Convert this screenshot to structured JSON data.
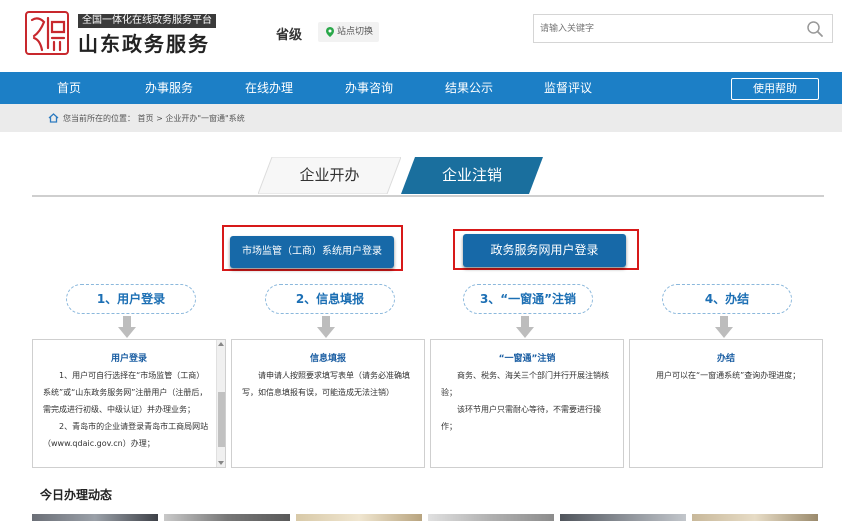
{
  "header": {
    "logo_subtitle": "全国一体化在线政务服务平台",
    "logo_title": "山东政务服务",
    "region": "省级",
    "region_switch_label": "站点切换",
    "search_placeholder": "请输入关键字"
  },
  "nav": {
    "items": [
      {
        "label": "首页"
      },
      {
        "label": "办事服务"
      },
      {
        "label": "在线办理"
      },
      {
        "label": "办事咨询"
      },
      {
        "label": "结果公示"
      },
      {
        "label": "监督评议"
      }
    ],
    "help_label": "使用帮助"
  },
  "breadcrumb": {
    "text": "您当前所在的位置： 首页 > 企业开办\"一窗通\"系统"
  },
  "tabs": [
    {
      "label": "企业开办",
      "active": false
    },
    {
      "label": "企业注销",
      "active": true
    }
  ],
  "login_buttons": {
    "market": "市场监管（工商）系统用户登录",
    "portal": "政务服务网用户登录"
  },
  "steps": [
    {
      "pill": "1、用户登录",
      "title": "用户登录",
      "paragraphs": [
        "1、用户可自行选择在“市场监管（工商）系统”或“山东政务服务网”注册用户（注册后，需完成进行初级、中级认证）并办理业务；",
        "2、青岛市的企业请登录青岛市工商局网站（www.qdaic.gov.cn）办理；"
      ]
    },
    {
      "pill": "2、信息填报",
      "title": "信息填报",
      "paragraphs": [
        "请申请人按照要求填写表单（请务必准确填写，如信息填报有误，可能造成无法注销）"
      ]
    },
    {
      "pill": "3、“一窗通”注销",
      "title": "“一窗通”注销",
      "paragraphs": [
        "商务、税务、海关三个部门并行开展注销核验；",
        "该环节用户只需耐心等待，不需要进行操作；"
      ]
    },
    {
      "pill": "4、办结",
      "title": "办结",
      "paragraphs": [
        "用户可以在“一窗通系统”查询办理进度；"
      ]
    }
  ],
  "today_section": {
    "title": "今日办理动态"
  },
  "colors": {
    "primary": "#1c7fc6",
    "button": "#1769a8",
    "active_tab": "#1a6f9e",
    "highlight": "#d71919"
  }
}
